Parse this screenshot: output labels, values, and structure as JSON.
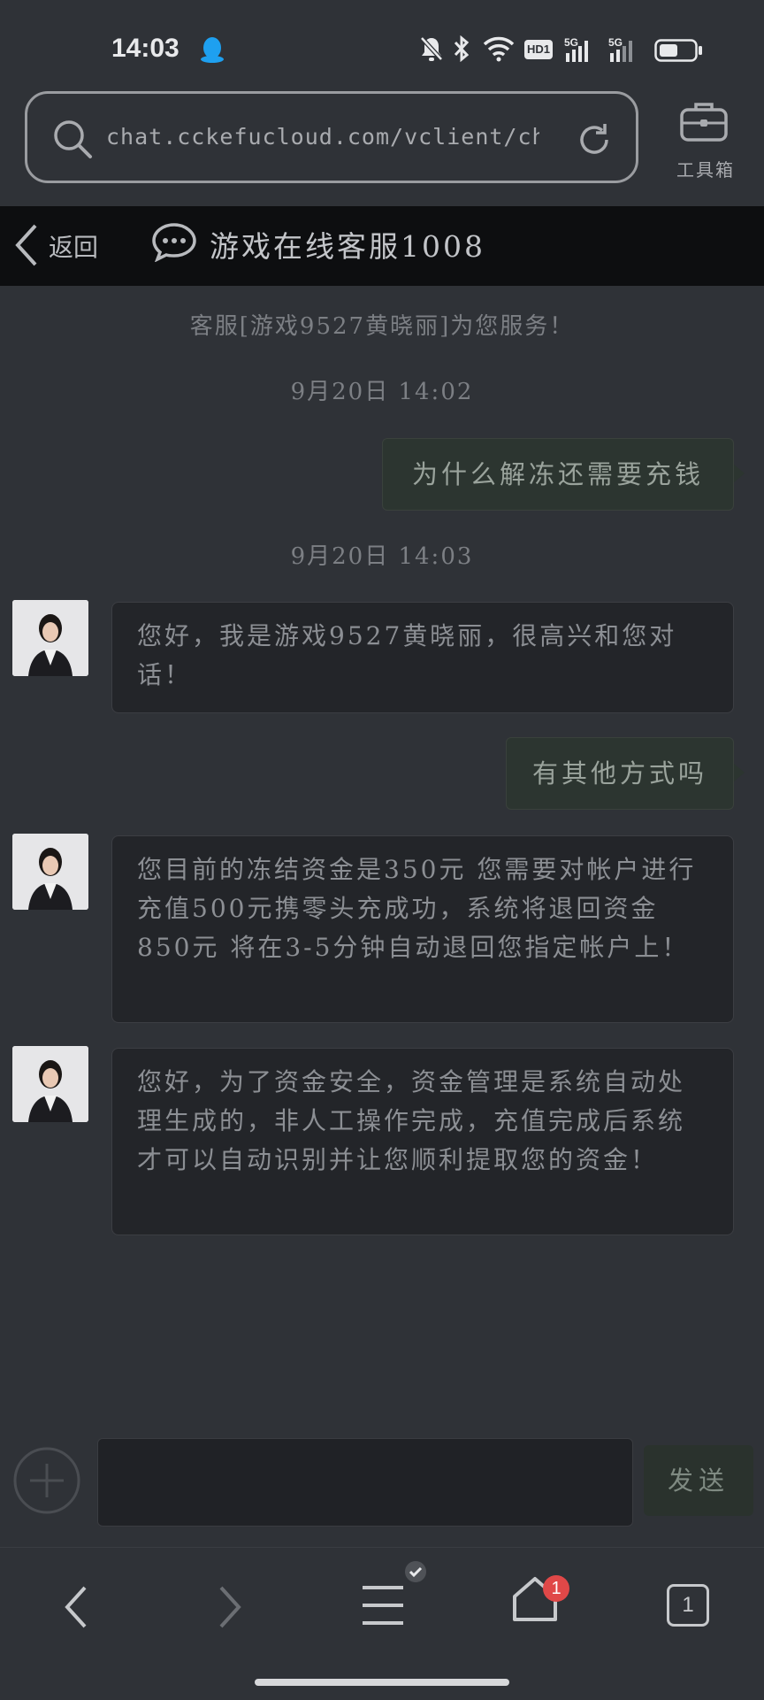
{
  "status_bar": {
    "time": "14:03",
    "network_5g_1": "5G",
    "network_5g_2": "5G",
    "hd": "HD1"
  },
  "browser": {
    "url": "chat.cckefucloud.com/vclient/chat/?...",
    "toolbox_label": "工具箱"
  },
  "header": {
    "back_label": "返回",
    "title": "游戏在线客服1008"
  },
  "messages": {
    "service_notice": "客服[游戏9527黄晓丽]为您服务！",
    "time1": "9月20日 14:02",
    "user1": "为什么解冻还需要充钱",
    "time2": "9月20日 14:03",
    "agent1": "您好，我是游戏9527黄晓丽，很高兴和您对话！",
    "user2": "有其他方式吗",
    "agent2": "您目前的冻结资金是350元 您需要对帐户进行充值500元携零头充成功，系统将退回资金850元 将在3-5分钟自动退回您指定帐户上！",
    "agent3": "您好，为了资金安全，资金管理是系统自动处理生成的，非人工操作完成，充值完成后系统才可以自动识别并让您顺利提取您的资金！"
  },
  "composer": {
    "send_label": "发送",
    "input_value": ""
  },
  "nav": {
    "home_badge": "1",
    "tabs_count": "1"
  },
  "colors": {
    "background": "#2f3237",
    "header": "#0d0e10",
    "user_bubble": "#2c3530",
    "agent_bubble": "#232529"
  }
}
